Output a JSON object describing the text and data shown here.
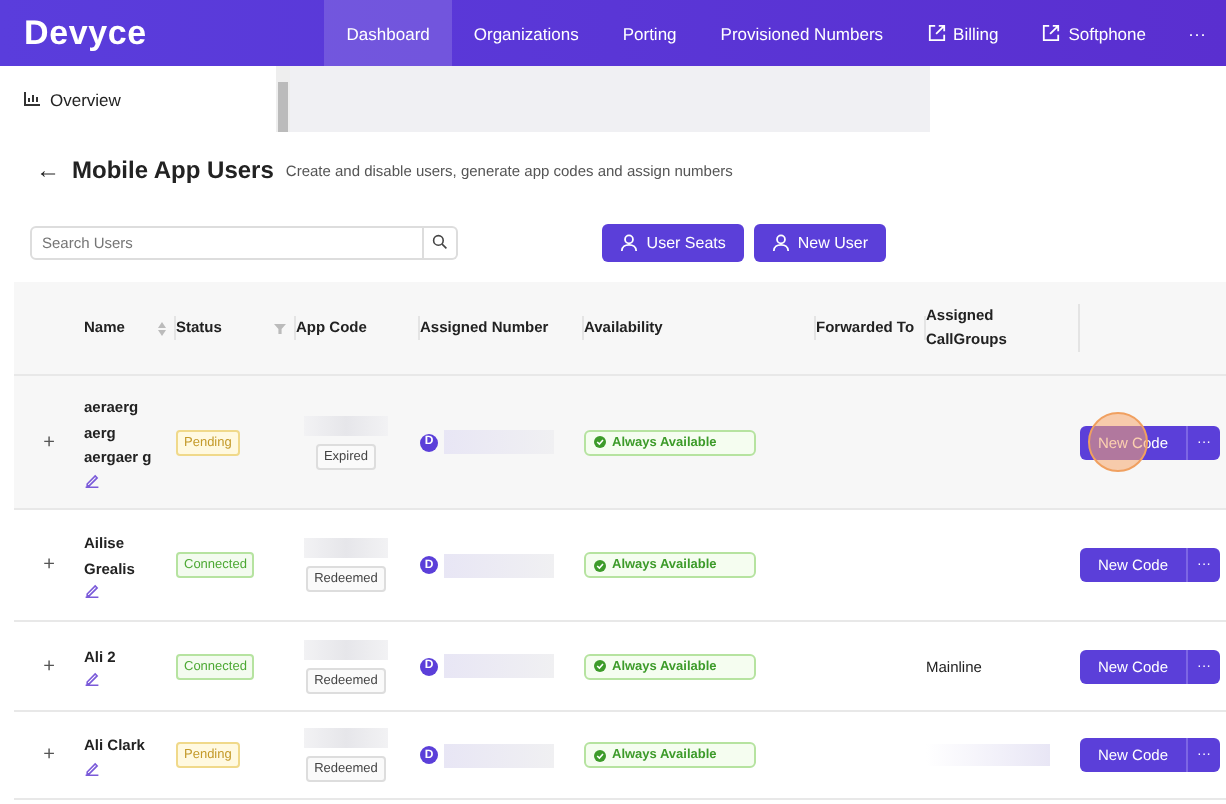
{
  "nav": {
    "logo": "Devyce",
    "items": [
      {
        "label": "Dashboard",
        "selected": true,
        "external": false
      },
      {
        "label": "Organizations",
        "selected": false,
        "external": false
      },
      {
        "label": "Porting",
        "selected": false,
        "external": false
      },
      {
        "label": "Provisioned Numbers",
        "selected": false,
        "external": false
      },
      {
        "label": "Billing",
        "selected": false,
        "external": true
      },
      {
        "label": "Softphone",
        "selected": false,
        "external": true
      }
    ],
    "more": "···"
  },
  "sidebar": {
    "items": [
      {
        "label": "Overview"
      }
    ]
  },
  "header": {
    "back": "←",
    "title": "Mobile App Users",
    "subtitle": "Create and disable users, generate app codes and assign numbers"
  },
  "search": {
    "placeholder": "Search Users"
  },
  "buttons": [
    "User Seats",
    "New User"
  ],
  "table": {
    "columns": [
      "Name",
      "Status",
      "App Code",
      "Assigned Number",
      "Availability",
      "Forwarded To",
      "Assigned CallGroups"
    ],
    "rows": [
      {
        "expand": "+",
        "name": "aeraerg aerg aergaer g",
        "status": {
          "label": "Pending",
          "kind": "pending"
        },
        "app_code": "Expired",
        "avatar": "D",
        "availability": "Always Available",
        "callgroups": "",
        "action": "New Code",
        "more": "···",
        "clicked": true
      },
      {
        "expand": "+",
        "name": "Ailise Grealis",
        "status": {
          "label": "Connected",
          "kind": "connected"
        },
        "app_code": "Redeemed",
        "avatar": "D",
        "availability": "Always Available",
        "callgroups": "",
        "action": "New Code",
        "more": "···",
        "clicked": false
      },
      {
        "expand": "+",
        "name": "Ali 2",
        "status": {
          "label": "Connected",
          "kind": "connected"
        },
        "app_code": "Redeemed",
        "avatar": "D",
        "availability": "Always Available",
        "callgroups": "Mainline",
        "action": "New Code",
        "more": "···",
        "clicked": false
      },
      {
        "expand": "+",
        "name": "Ali Clark",
        "status": {
          "label": "Pending",
          "kind": "pending"
        },
        "app_code": "Redeemed",
        "avatar": "D",
        "availability": "Always Available",
        "callgroups": "",
        "action": "New Code",
        "more": "···",
        "clicked": false
      }
    ]
  }
}
